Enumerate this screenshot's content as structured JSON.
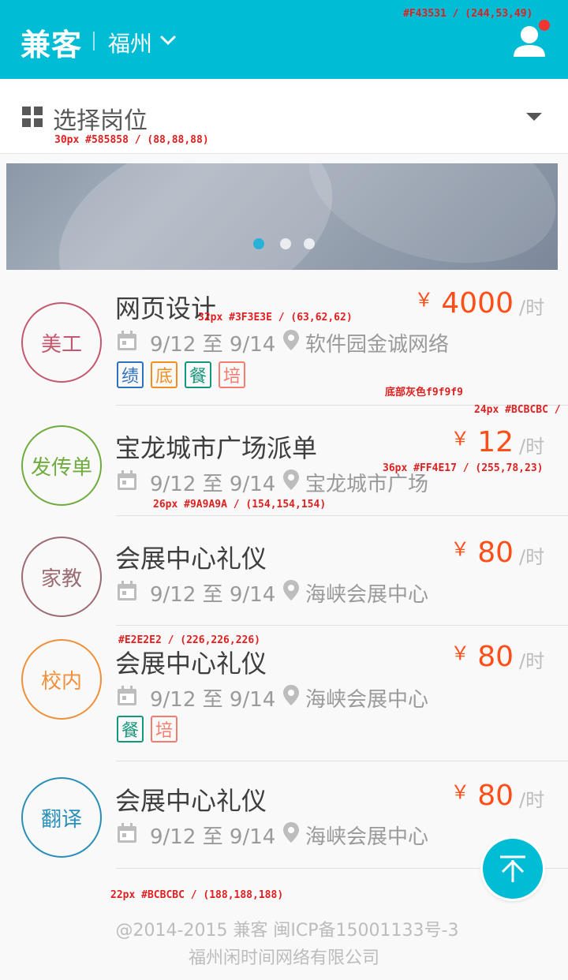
{
  "header": {
    "logo": "兼客",
    "city": "福州",
    "user_icon": "user-icon",
    "notification_color": "#F43531",
    "color_note": "#F43531 / (244,53,49)"
  },
  "selector": {
    "label": "选择岗位",
    "spec": "30px #585858 / (88,88,88)"
  },
  "banner": {
    "slide_count": 3,
    "active_slide": 1
  },
  "jobs": [
    {
      "badge": "美工",
      "badge_color": "#c4586e",
      "title": "网页设计",
      "date": "9/12 至 9/14",
      "place": "软件园金诚网络",
      "price": "4000",
      "currency": "￥",
      "unit": "/时",
      "tags": [
        {
          "label": "绩",
          "color": "#2f6fbf"
        },
        {
          "label": "底",
          "color": "#f09020"
        },
        {
          "label": "餐",
          "color": "#14967a"
        },
        {
          "label": "培",
          "color": "#f47d6d"
        }
      ]
    },
    {
      "badge": "发传单",
      "badge_color": "#6fac3e",
      "title": "宝龙城市广场派单",
      "date": "9/12 至 9/14",
      "place": "宝龙城市广场",
      "price": "12",
      "currency": "￥",
      "unit": "/时",
      "tags": []
    },
    {
      "badge": "家教",
      "badge_color": "#9c6b72",
      "title": "会展中心礼仪",
      "date": "9/12 至 9/14",
      "place": "海峡会展中心",
      "price": "80",
      "currency": "￥",
      "unit": "/时",
      "tags": []
    },
    {
      "badge": "校内",
      "badge_color": "#f0903a",
      "title": "会展中心礼仪",
      "date": "9/12 至 9/14",
      "place": "海峡会展中心",
      "price": "80",
      "currency": "￥",
      "unit": "/时",
      "tags": [
        {
          "label": "餐",
          "color": "#14967a"
        },
        {
          "label": "培",
          "color": "#f47d6d"
        }
      ]
    },
    {
      "badge": "翻译",
      "badge_color": "#2a8fb8",
      "title": "会展中心礼仪",
      "date": "9/12 至 9/14",
      "place": "海峡会展中心",
      "price": "80",
      "currency": "￥",
      "unit": "/时",
      "tags": []
    }
  ],
  "annotations": {
    "title_spec": "32px #3F3E3E / (63,62,62)",
    "bg_spec": "底部灰色f9f9f9",
    "unit_spec": "24px #BCBCBC /",
    "price_spec": "36px #FF4E17 / (255,78,23)",
    "meta_spec": "26px #9A9A9A / (154,154,154)",
    "divider_spec": "#E2E2E2 / (226,226,226)",
    "footer_spec": "22px #BCBCBC / (188,188,188)"
  },
  "footer": {
    "line1": "@2014-2015 兼客   闽ICP备15001133号-3",
    "line2": "福州闲时间网络有限公司"
  },
  "back_to_top_icon": "arrow-up-icon"
}
